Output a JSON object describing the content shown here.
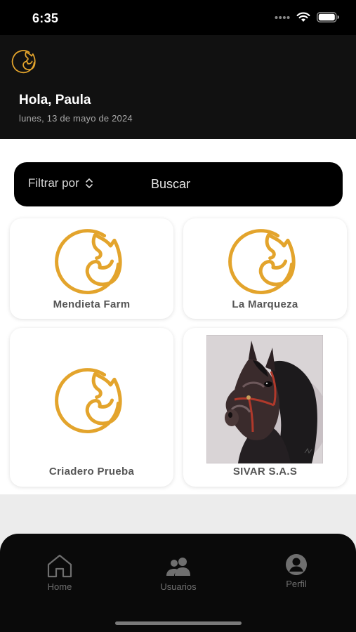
{
  "status_bar": {
    "time": "6:35",
    "icons": [
      "signal-dots-icon",
      "wifi-icon",
      "battery-icon"
    ]
  },
  "header": {
    "logo_icon": "horse-head-logo-icon",
    "greeting": "Hola, Paula",
    "date": "lunes, 13 de mayo de 2024"
  },
  "search": {
    "filter_label": "Filtrar por",
    "filter_icon": "chevron-up-down-icon",
    "placeholder": "Buscar"
  },
  "farms": [
    {
      "name": "Mendieta Farm",
      "image": "horse-head-logo-icon"
    },
    {
      "name": "La Marqueza",
      "image": "horse-head-logo-icon"
    },
    {
      "name": "Criadero Prueba",
      "image": "horse-head-logo-icon"
    },
    {
      "name": "SIVAR S.A.S",
      "image": "horse-portrait-photo"
    }
  ],
  "tab_bar": {
    "items": [
      {
        "label": "Home",
        "icon": "home-icon"
      },
      {
        "label": "Usuarios",
        "icon": "users-icon"
      },
      {
        "label": "Perfil",
        "icon": "profile-icon"
      }
    ]
  },
  "colors": {
    "accent_gold": "#e3a42c",
    "header_bg": "#111111",
    "tab_inactive": "#6f6f6f"
  }
}
